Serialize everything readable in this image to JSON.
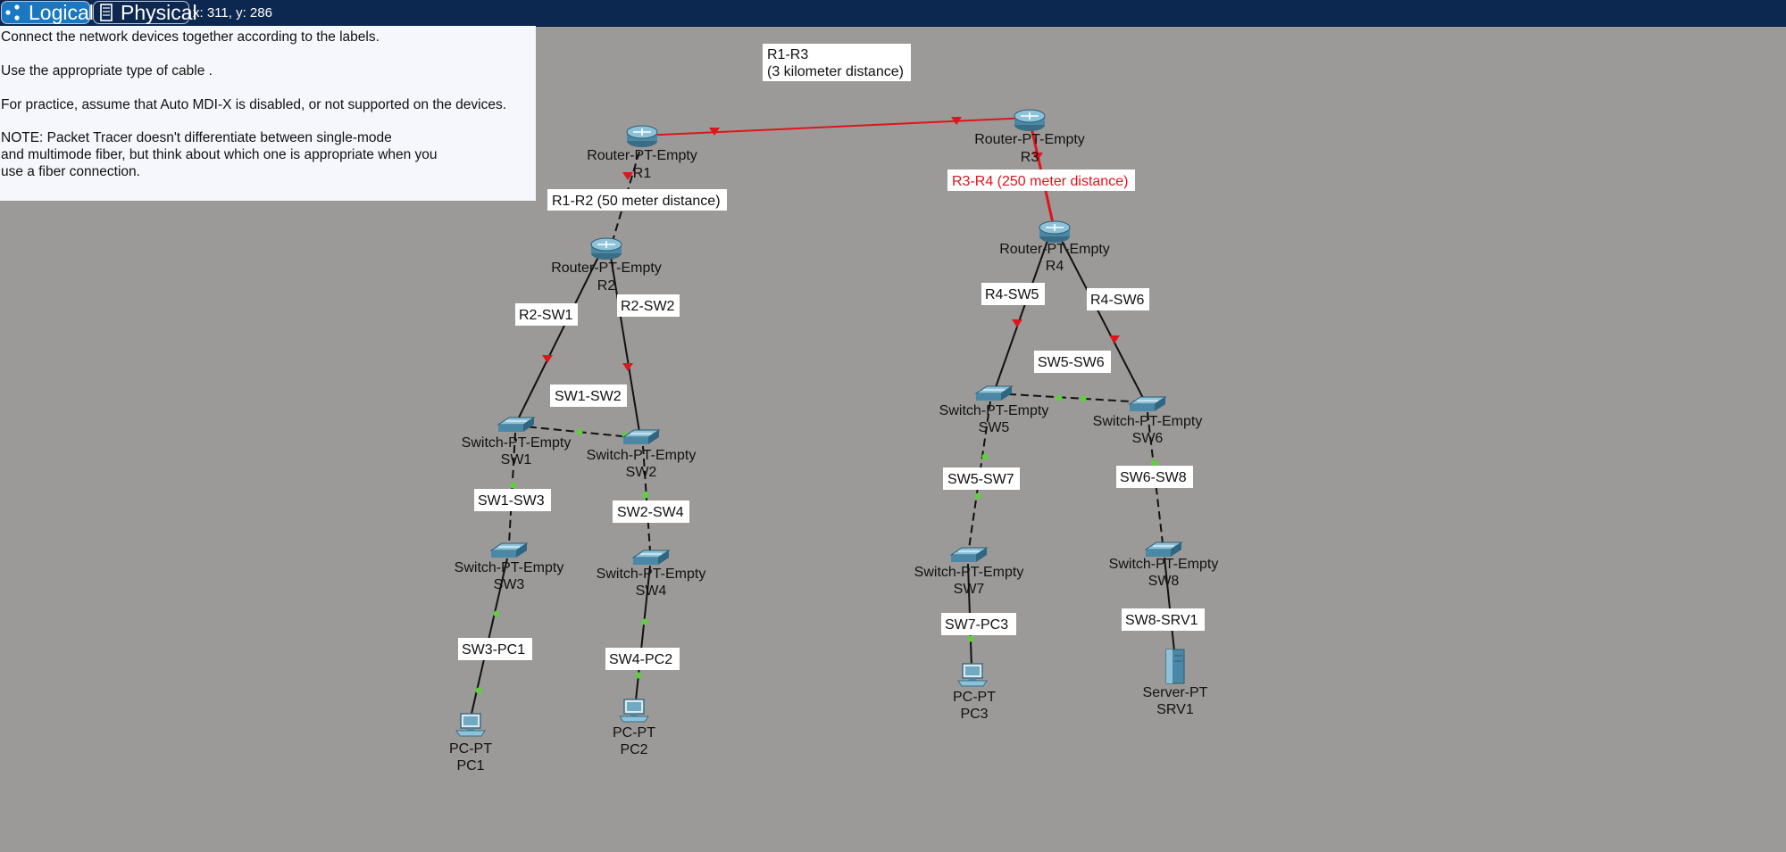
{
  "tabs": {
    "logical": "Logical",
    "physical": "Physical"
  },
  "coords": "x: 311, y: 286",
  "note": [
    "Connect the network devices together according to the labels.",
    "Use the appropriate type of cable .",
    "For practice, assume that Auto MDI-X is disabled, or not supported on the devices.",
    "NOTE: Packet Tracer doesn't differentiate between single-mode",
    "and multimode fiber, but think about which one is appropriate when you",
    "use a fiber connection."
  ],
  "devices": {
    "r1": {
      "type": "Router-PT-Empty",
      "name": "R1"
    },
    "r2": {
      "type": "Router-PT-Empty",
      "name": "R2"
    },
    "r3": {
      "type": "Router-PT-Empty",
      "name": "R3"
    },
    "r4": {
      "type": "Router-PT-Empty",
      "name": "R4"
    },
    "sw1": {
      "type": "Switch-PT-Empty",
      "name": "SW1"
    },
    "sw2": {
      "type": "Switch-PT-Empty",
      "name": "SW2"
    },
    "sw3": {
      "type": "Switch-PT-Empty",
      "name": "SW3"
    },
    "sw4": {
      "type": "Switch-PT-Empty",
      "name": "SW4"
    },
    "sw5": {
      "type": "Switch-PT-Empty",
      "name": "SW5"
    },
    "sw6": {
      "type": "Switch-PT-Empty",
      "name": "SW6"
    },
    "sw7": {
      "type": "Switch-PT-Empty",
      "name": "SW7"
    },
    "sw8": {
      "type": "Switch-PT-Empty",
      "name": "SW8"
    },
    "pc1": {
      "type": "PC-PT",
      "name": "PC1"
    },
    "pc2": {
      "type": "PC-PT",
      "name": "PC2"
    },
    "pc3": {
      "type": "PC-PT",
      "name": "PC3"
    },
    "srv1": {
      "type": "Server-PT",
      "name": "SRV1"
    }
  },
  "links": {
    "r1_r3": {
      "line1": "R1-R3",
      "line2": "(3 kilometer distance)"
    },
    "r1_r2": "R1-R2 (50 meter distance)",
    "r3_r4": "R3-R4 (250 meter distance)",
    "r2_sw1": "R2-SW1",
    "r2_sw2": "R2-SW2",
    "sw1_sw2": "SW1-SW2",
    "sw1_sw3": "SW1-SW3",
    "sw2_sw4": "SW2-SW4",
    "sw3_pc1": "SW3-PC1",
    "sw4_pc2": "SW4-PC2",
    "r4_sw5": "R4-SW5",
    "r4_sw6": "R4-SW6",
    "sw5_sw6": "SW5-SW6",
    "sw5_sw7": "SW5-SW7",
    "sw6_sw8": "SW6-SW8",
    "sw7_pc3": "SW7-PC3",
    "sw8_srv1": "SW8-SRV1"
  },
  "colors": {
    "titlebar": "#0d2850",
    "workspace": "#9b9a98",
    "link_down": "#e0141c",
    "link_up": "#5cd13a"
  }
}
